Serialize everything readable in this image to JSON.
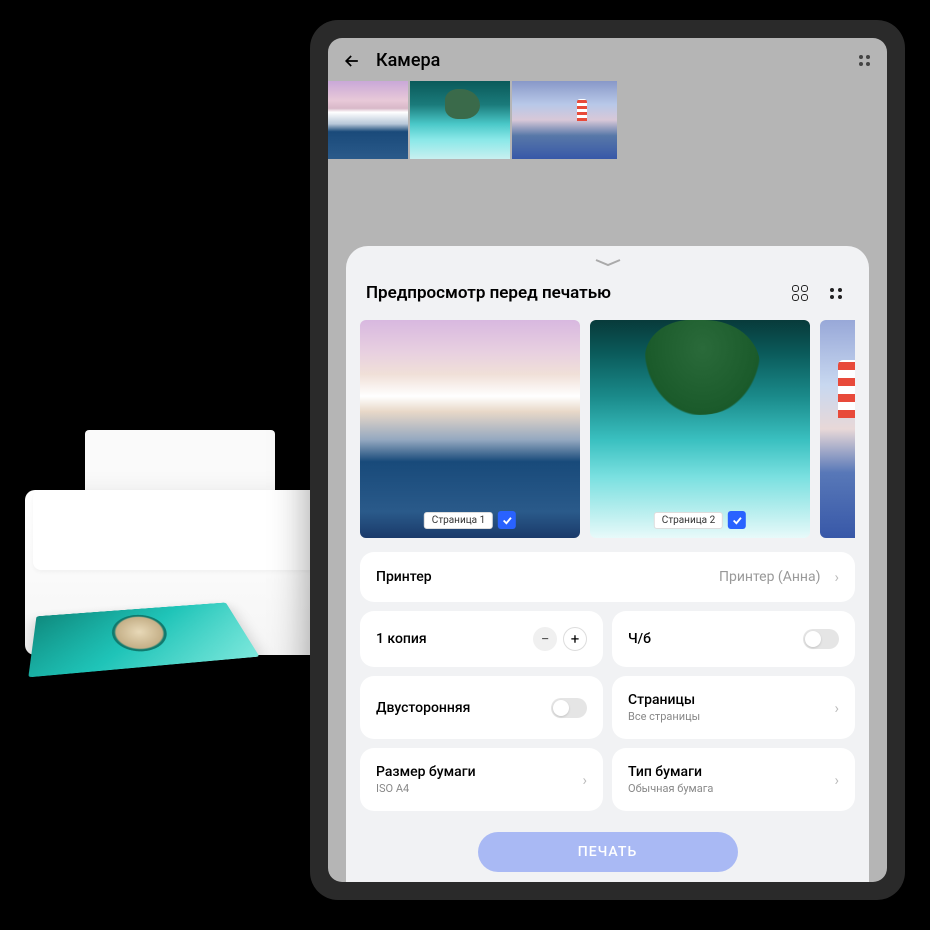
{
  "gallery": {
    "title": "Камера"
  },
  "panel": {
    "title": "Предпросмотр перед печатью"
  },
  "previews": [
    {
      "label": "Страница 1",
      "checked": true
    },
    {
      "label": "Страница 2",
      "checked": true
    }
  ],
  "settings": {
    "printer": {
      "label": "Принтер",
      "value": "Принтер (Анна)"
    },
    "copies": {
      "label": "1 копия"
    },
    "bw": {
      "label": "Ч/б"
    },
    "duplex": {
      "label": "Двусторонняя"
    },
    "pages": {
      "label": "Страницы",
      "sub": "Все страницы"
    },
    "paperSize": {
      "label": "Размер бумаги",
      "sub": "ISO A4"
    },
    "paperType": {
      "label": "Тип бумаги",
      "sub": "Обычная бумага"
    }
  },
  "printButton": "ПЕЧАТЬ"
}
